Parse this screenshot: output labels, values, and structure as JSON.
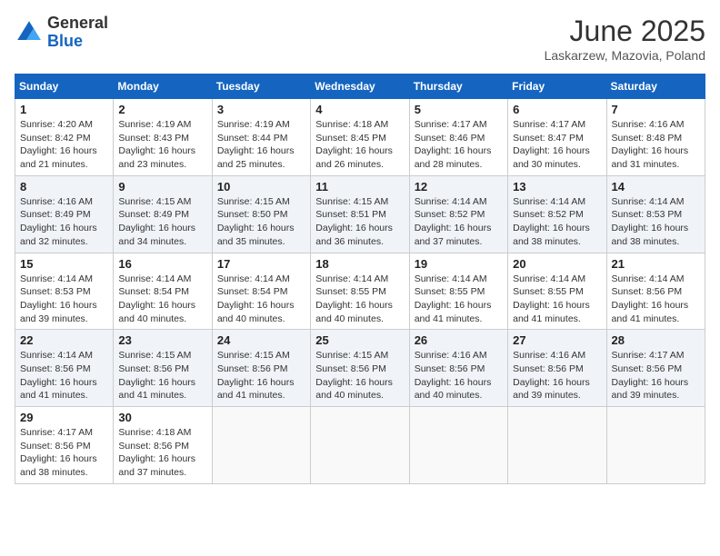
{
  "header": {
    "logo_general": "General",
    "logo_blue": "Blue",
    "month_title": "June 2025",
    "subtitle": "Laskarzew, Mazovia, Poland"
  },
  "calendar": {
    "days_of_week": [
      "Sunday",
      "Monday",
      "Tuesday",
      "Wednesday",
      "Thursday",
      "Friday",
      "Saturday"
    ],
    "weeks": [
      [
        {
          "day": "1",
          "sunrise": "Sunrise: 4:20 AM",
          "sunset": "Sunset: 8:42 PM",
          "daylight": "Daylight: 16 hours and 21 minutes."
        },
        {
          "day": "2",
          "sunrise": "Sunrise: 4:19 AM",
          "sunset": "Sunset: 8:43 PM",
          "daylight": "Daylight: 16 hours and 23 minutes."
        },
        {
          "day": "3",
          "sunrise": "Sunrise: 4:19 AM",
          "sunset": "Sunset: 8:44 PM",
          "daylight": "Daylight: 16 hours and 25 minutes."
        },
        {
          "day": "4",
          "sunrise": "Sunrise: 4:18 AM",
          "sunset": "Sunset: 8:45 PM",
          "daylight": "Daylight: 16 hours and 26 minutes."
        },
        {
          "day": "5",
          "sunrise": "Sunrise: 4:17 AM",
          "sunset": "Sunset: 8:46 PM",
          "daylight": "Daylight: 16 hours and 28 minutes."
        },
        {
          "day": "6",
          "sunrise": "Sunrise: 4:17 AM",
          "sunset": "Sunset: 8:47 PM",
          "daylight": "Daylight: 16 hours and 30 minutes."
        },
        {
          "day": "7",
          "sunrise": "Sunrise: 4:16 AM",
          "sunset": "Sunset: 8:48 PM",
          "daylight": "Daylight: 16 hours and 31 minutes."
        }
      ],
      [
        {
          "day": "8",
          "sunrise": "Sunrise: 4:16 AM",
          "sunset": "Sunset: 8:49 PM",
          "daylight": "Daylight: 16 hours and 32 minutes."
        },
        {
          "day": "9",
          "sunrise": "Sunrise: 4:15 AM",
          "sunset": "Sunset: 8:49 PM",
          "daylight": "Daylight: 16 hours and 34 minutes."
        },
        {
          "day": "10",
          "sunrise": "Sunrise: 4:15 AM",
          "sunset": "Sunset: 8:50 PM",
          "daylight": "Daylight: 16 hours and 35 minutes."
        },
        {
          "day": "11",
          "sunrise": "Sunrise: 4:15 AM",
          "sunset": "Sunset: 8:51 PM",
          "daylight": "Daylight: 16 hours and 36 minutes."
        },
        {
          "day": "12",
          "sunrise": "Sunrise: 4:14 AM",
          "sunset": "Sunset: 8:52 PM",
          "daylight": "Daylight: 16 hours and 37 minutes."
        },
        {
          "day": "13",
          "sunrise": "Sunrise: 4:14 AM",
          "sunset": "Sunset: 8:52 PM",
          "daylight": "Daylight: 16 hours and 38 minutes."
        },
        {
          "day": "14",
          "sunrise": "Sunrise: 4:14 AM",
          "sunset": "Sunset: 8:53 PM",
          "daylight": "Daylight: 16 hours and 38 minutes."
        }
      ],
      [
        {
          "day": "15",
          "sunrise": "Sunrise: 4:14 AM",
          "sunset": "Sunset: 8:53 PM",
          "daylight": "Daylight: 16 hours and 39 minutes."
        },
        {
          "day": "16",
          "sunrise": "Sunrise: 4:14 AM",
          "sunset": "Sunset: 8:54 PM",
          "daylight": "Daylight: 16 hours and 40 minutes."
        },
        {
          "day": "17",
          "sunrise": "Sunrise: 4:14 AM",
          "sunset": "Sunset: 8:54 PM",
          "daylight": "Daylight: 16 hours and 40 minutes."
        },
        {
          "day": "18",
          "sunrise": "Sunrise: 4:14 AM",
          "sunset": "Sunset: 8:55 PM",
          "daylight": "Daylight: 16 hours and 40 minutes."
        },
        {
          "day": "19",
          "sunrise": "Sunrise: 4:14 AM",
          "sunset": "Sunset: 8:55 PM",
          "daylight": "Daylight: 16 hours and 41 minutes."
        },
        {
          "day": "20",
          "sunrise": "Sunrise: 4:14 AM",
          "sunset": "Sunset: 8:55 PM",
          "daylight": "Daylight: 16 hours and 41 minutes."
        },
        {
          "day": "21",
          "sunrise": "Sunrise: 4:14 AM",
          "sunset": "Sunset: 8:56 PM",
          "daylight": "Daylight: 16 hours and 41 minutes."
        }
      ],
      [
        {
          "day": "22",
          "sunrise": "Sunrise: 4:14 AM",
          "sunset": "Sunset: 8:56 PM",
          "daylight": "Daylight: 16 hours and 41 minutes."
        },
        {
          "day": "23",
          "sunrise": "Sunrise: 4:15 AM",
          "sunset": "Sunset: 8:56 PM",
          "daylight": "Daylight: 16 hours and 41 minutes."
        },
        {
          "day": "24",
          "sunrise": "Sunrise: 4:15 AM",
          "sunset": "Sunset: 8:56 PM",
          "daylight": "Daylight: 16 hours and 41 minutes."
        },
        {
          "day": "25",
          "sunrise": "Sunrise: 4:15 AM",
          "sunset": "Sunset: 8:56 PM",
          "daylight": "Daylight: 16 hours and 40 minutes."
        },
        {
          "day": "26",
          "sunrise": "Sunrise: 4:16 AM",
          "sunset": "Sunset: 8:56 PM",
          "daylight": "Daylight: 16 hours and 40 minutes."
        },
        {
          "day": "27",
          "sunrise": "Sunrise: 4:16 AM",
          "sunset": "Sunset: 8:56 PM",
          "daylight": "Daylight: 16 hours and 39 minutes."
        },
        {
          "day": "28",
          "sunrise": "Sunrise: 4:17 AM",
          "sunset": "Sunset: 8:56 PM",
          "daylight": "Daylight: 16 hours and 39 minutes."
        }
      ],
      [
        {
          "day": "29",
          "sunrise": "Sunrise: 4:17 AM",
          "sunset": "Sunset: 8:56 PM",
          "daylight": "Daylight: 16 hours and 38 minutes."
        },
        {
          "day": "30",
          "sunrise": "Sunrise: 4:18 AM",
          "sunset": "Sunset: 8:56 PM",
          "daylight": "Daylight: 16 hours and 37 minutes."
        },
        null,
        null,
        null,
        null,
        null
      ]
    ]
  }
}
